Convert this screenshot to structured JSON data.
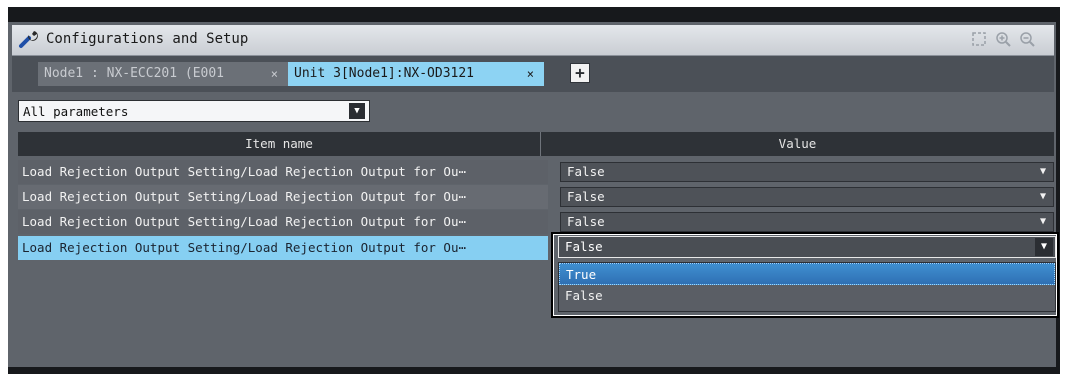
{
  "window": {
    "title": "Configurations and Setup"
  },
  "tabs": [
    {
      "label": "Node1 : NX-ECC201 (E001",
      "close": "×"
    },
    {
      "label": "Unit 3[Node1]:NX-OD3121",
      "close": "×"
    }
  ],
  "add_tab_label": "+",
  "filter": {
    "selected": "All parameters"
  },
  "table": {
    "columns": [
      "Item name",
      "Value"
    ],
    "rows": [
      {
        "name": "Load Rejection Output Setting/Load Rejection Output for Ou⋯",
        "value": "False"
      },
      {
        "name": "Load Rejection Output Setting/Load Rejection Output for Ou⋯",
        "value": "False"
      },
      {
        "name": "Load Rejection Output Setting/Load Rejection Output for Ou⋯",
        "value": "False"
      },
      {
        "name": "Load Rejection Output Setting/Load Rejection Output for Ou⋯",
        "value": "False"
      }
    ]
  },
  "dropdown": {
    "current": "False",
    "options": [
      "True",
      "False"
    ],
    "highlighted": "True"
  },
  "icons": {
    "title": "wrench-icon",
    "toolbar": [
      "fit-icon",
      "zoom-in-icon",
      "zoom-out-icon"
    ],
    "dropdown": "chevron-down-icon"
  },
  "colors": {
    "selected_row": "#86cff2",
    "active_tab": "#8dd3f3",
    "highlight_option": "#2f70b4"
  }
}
